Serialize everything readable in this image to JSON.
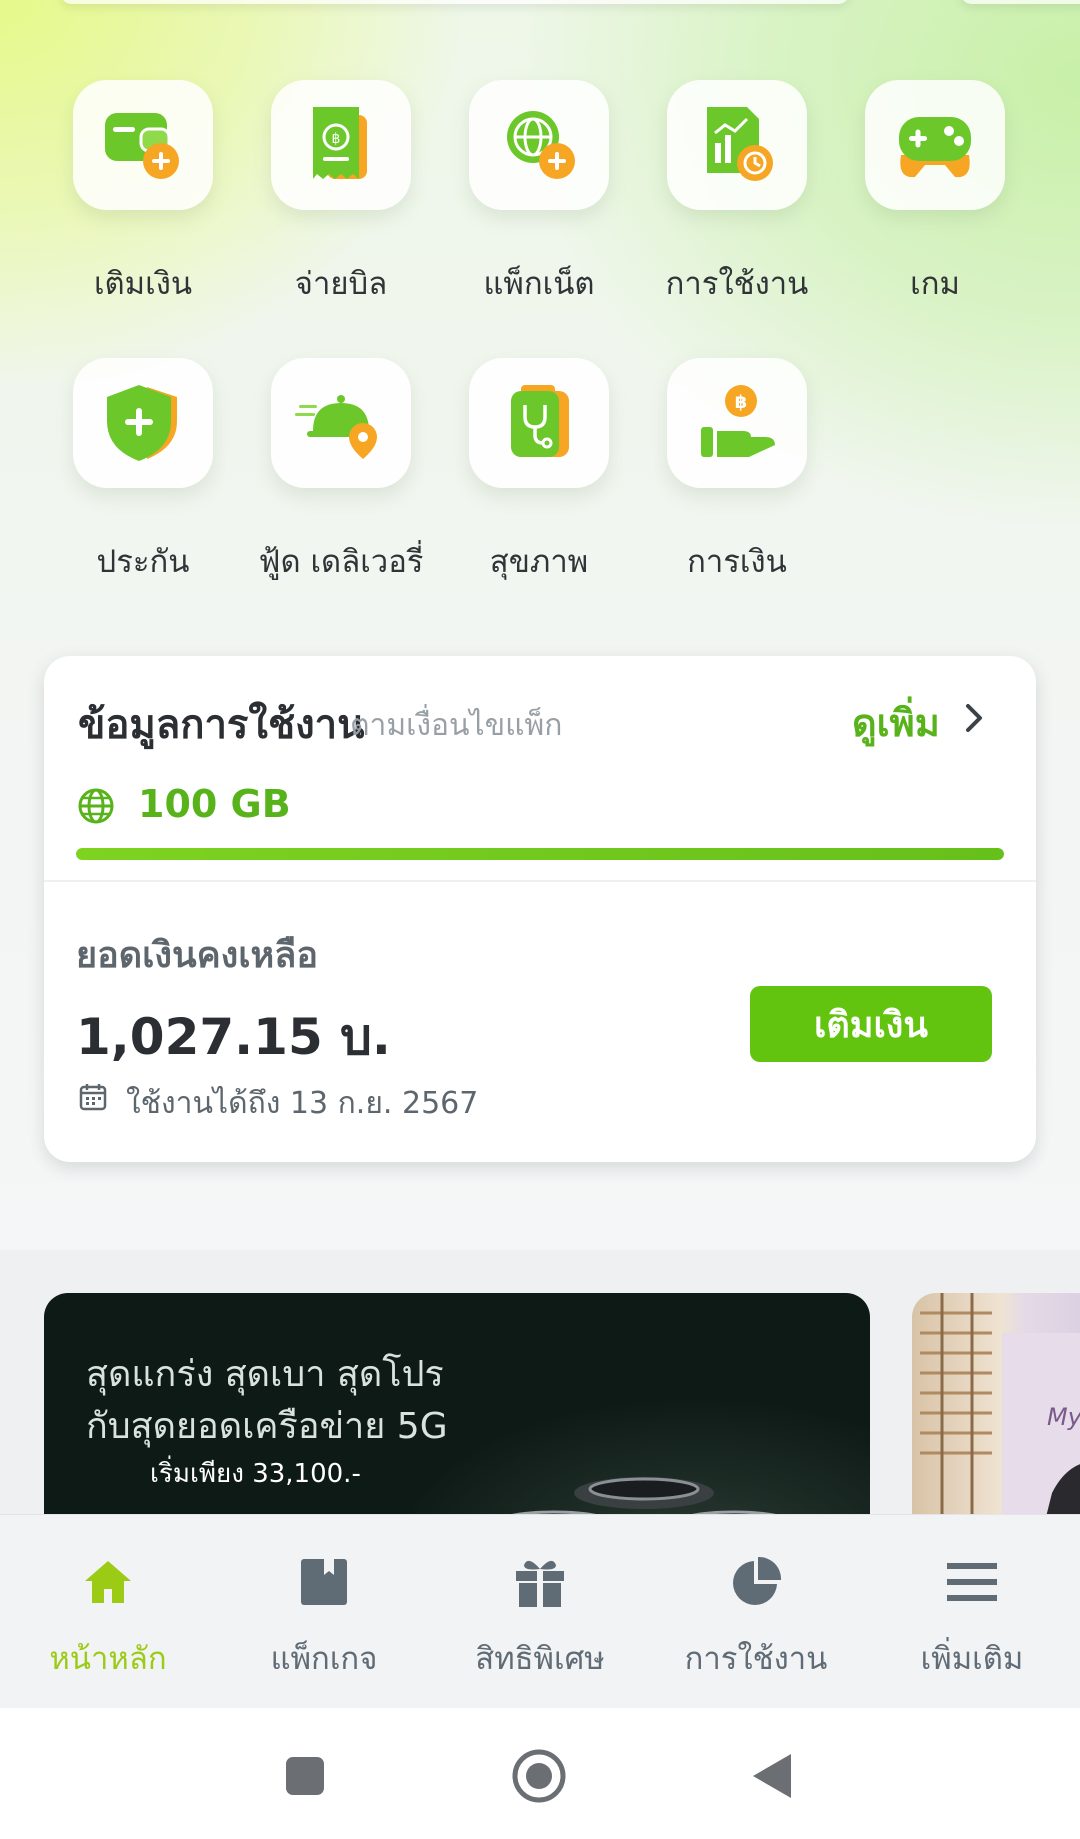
{
  "services": [
    {
      "label": "เติมเงิน",
      "icon": "wallet-plus-icon"
    },
    {
      "label": "จ่ายบิล",
      "icon": "bill-receipt-icon"
    },
    {
      "label": "แพ็กเน็ต",
      "icon": "globe-plus-icon"
    },
    {
      "label": "การใช้งาน",
      "icon": "usage-chart-icon"
    },
    {
      "label": "เกม",
      "icon": "gamepad-icon"
    },
    {
      "label": "ประกัน",
      "icon": "shield-plus-icon"
    },
    {
      "label": "ฟู้ด เดลิเวอรี่",
      "icon": "food-delivery-icon"
    },
    {
      "label": "สุขภาพ",
      "icon": "health-stethoscope-icon"
    },
    {
      "label": "การเงิน",
      "icon": "finance-hand-coin-icon"
    }
  ],
  "usage_card": {
    "title": "ข้อมูลการใช้งาน",
    "subtitle": "ตามเงื่อนไขแพ็ก",
    "see_more": "ดูเพิ่ม",
    "data_amount": "100 GB",
    "data_fraction_remaining": 1.0,
    "balance_label": "ยอดเงินคงเหลือ",
    "balance_value": "1,027.15 บ.",
    "valid_until": "ใช้งานได้ถึง 13 ก.ย. 2567",
    "topup_button": "เติมเงิน"
  },
  "promos": [
    {
      "line1": "สุดแกร่ง สุดเบา สุดโปร",
      "line2": "กับสุดยอดเครือข่าย 5G",
      "price": "เริ่มเพียง 33,100.-"
    },
    {
      "text": "My"
    }
  ],
  "bottom_nav": [
    {
      "label": "หน้าหลัก",
      "icon": "home-icon",
      "active": true
    },
    {
      "label": "แพ็กเกจ",
      "icon": "package-bookmark-icon",
      "active": false
    },
    {
      "label": "สิทธิพิเศษ",
      "icon": "gift-icon",
      "active": false
    },
    {
      "label": "การใช้งาน",
      "icon": "pie-chart-icon",
      "active": false
    },
    {
      "label": "เพิ่มเติม",
      "icon": "menu-icon",
      "active": false
    }
  ],
  "colors": {
    "brand_green": "#62c40e",
    "accent_green_text": "#58b31b",
    "active_nav": "#9ccb16",
    "icon_orange": "#f6a623"
  }
}
